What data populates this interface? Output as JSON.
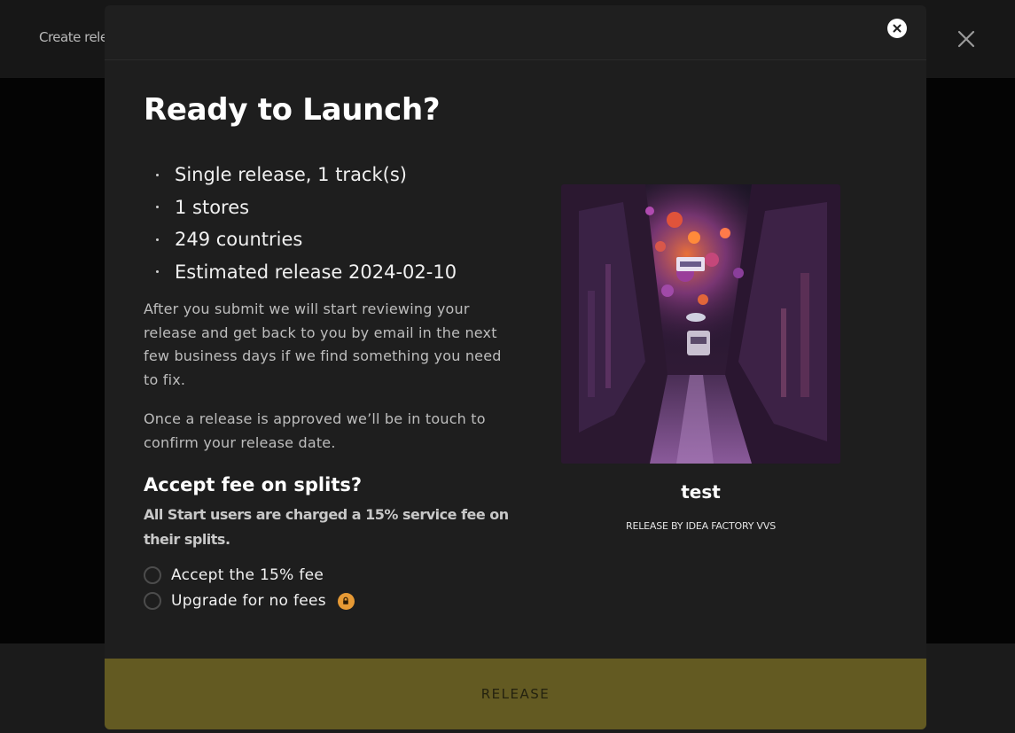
{
  "background": {
    "title": "Create relea",
    "close_icon": "close-icon"
  },
  "modal": {
    "close_icon": "close-circle-icon",
    "heading": "Ready to Launch?",
    "summary": [
      "Single release, 1 track(s)",
      "1 stores",
      "249 countries",
      "Estimated release 2024-02-10"
    ],
    "paragraphs": [
      "After you submit we will start reviewing your release and get back to you by email in the next few business days if we find something you need to fix.",
      "Once a release is approved we’ll be in touch to confirm your release date."
    ],
    "fee": {
      "heading": "Accept fee on splits?",
      "description": "All Start users are charged a 15% service fee on their splits.",
      "options": [
        {
          "label": "Accept the 15% fee",
          "selected": false
        },
        {
          "label": "Upgrade for no fees",
          "selected": false,
          "icon": "lock-icon"
        }
      ]
    },
    "release": {
      "artwork": "artwork-image",
      "title": "test",
      "by": "RELEASE BY IDEA FACTORY VVS"
    },
    "release_button": "RELEASE",
    "colors": {
      "release_button_bg": "#635a22",
      "lock_badge": "#e79a35"
    }
  }
}
